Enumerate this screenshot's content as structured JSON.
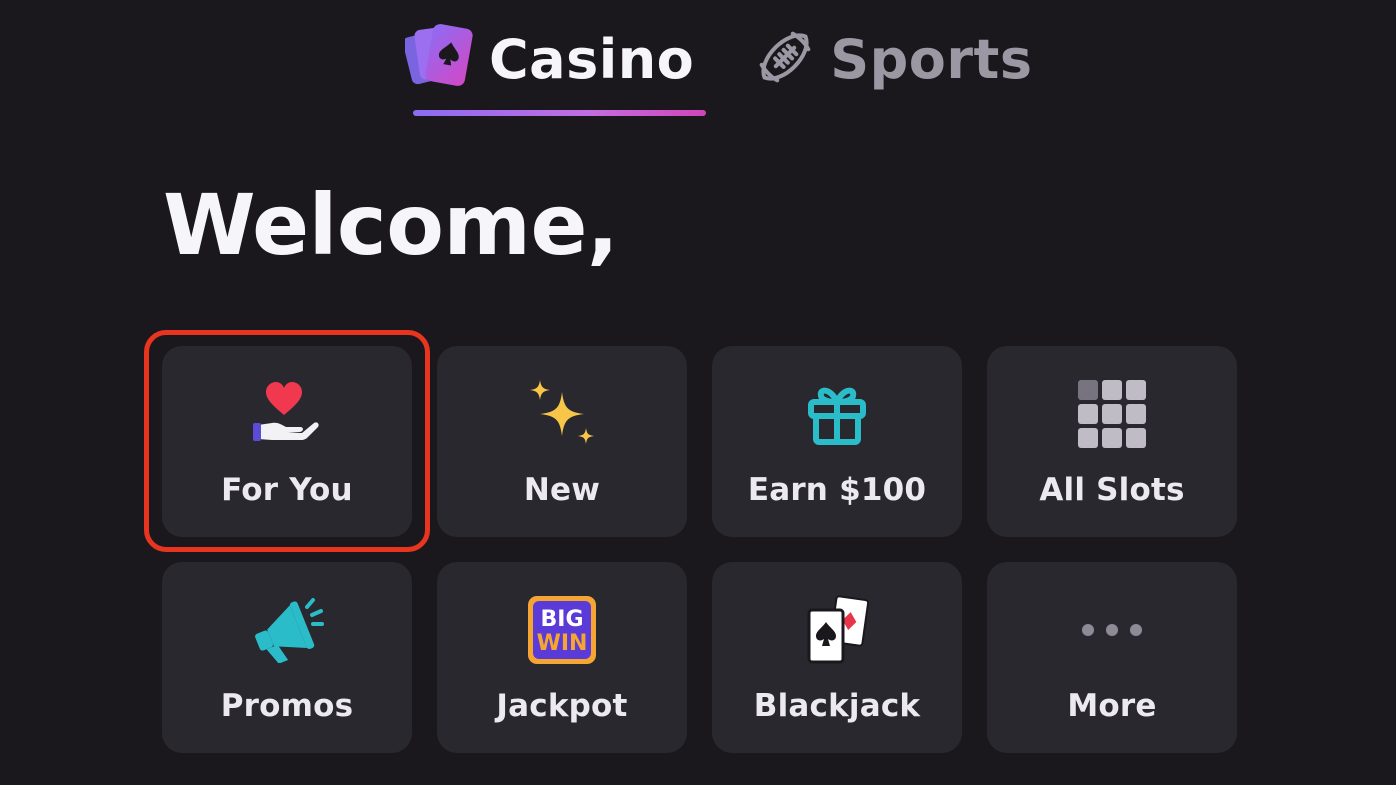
{
  "tabs": [
    {
      "label": "Casino",
      "icon": "playing-cards-icon",
      "active": true
    },
    {
      "label": "Sports",
      "icon": "football-icon",
      "active": false
    }
  ],
  "welcome": {
    "text": "Welcome,"
  },
  "tiles": [
    {
      "label": "For You",
      "icon": "heart-hand-icon",
      "selected": true
    },
    {
      "label": "New",
      "icon": "sparkles-icon"
    },
    {
      "label": "Earn $100",
      "icon": "gift-icon"
    },
    {
      "label": "All Slots",
      "icon": "grid-icon"
    },
    {
      "label": "Promos",
      "icon": "megaphone-icon"
    },
    {
      "label": "Jackpot",
      "icon": "big-win-icon",
      "badge_lines": [
        "BIG",
        "WIN"
      ]
    },
    {
      "label": "Blackjack",
      "icon": "cards-icon"
    },
    {
      "label": "More",
      "icon": "more-dots-icon"
    }
  ],
  "colors": {
    "background": "#1a181c",
    "tile": "#29282e",
    "selection": "#e8351f",
    "accent_start": "#8b6cf2",
    "accent_end": "#d045b8",
    "teal": "#2bbcc9"
  }
}
